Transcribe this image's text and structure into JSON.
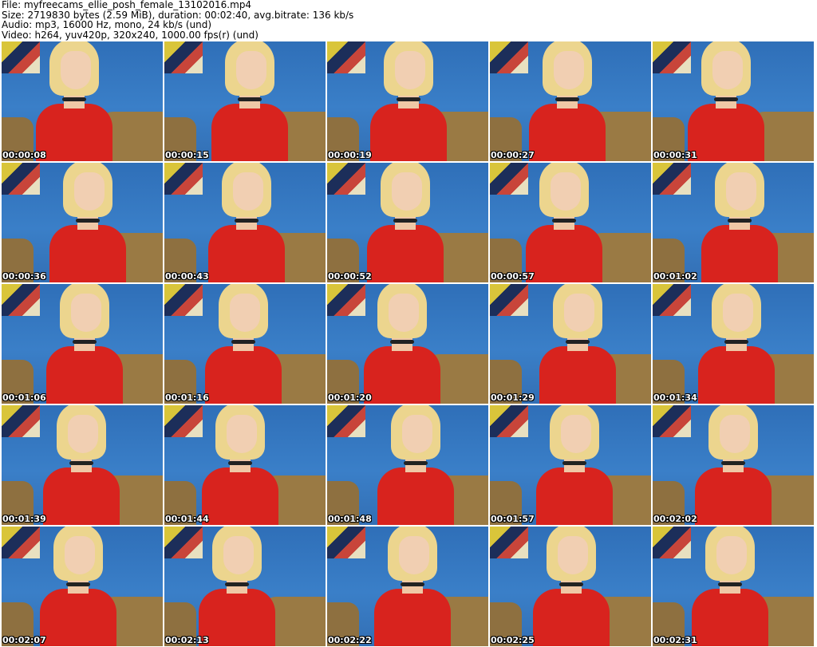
{
  "header": {
    "file": "File: myfreecams_ellie_posh_female_13102016.mp4",
    "size": "Size: 2719830 bytes (2.59 MiB), duration: 00:02:40, avg.bitrate: 136 kb/s",
    "audio": "Audio: mp3, 16000 Hz, mono, 24 kb/s (und)",
    "video": "Video: h264, yuv420p, 320x240, 1000.00 fps(r) (und)"
  },
  "thumbnails": [
    "00:00:08",
    "00:00:15",
    "00:00:19",
    "00:00:27",
    "00:00:31",
    "00:00:36",
    "00:00:43",
    "00:00:52",
    "00:00:57",
    "00:01:02",
    "00:01:06",
    "00:01:16",
    "00:01:20",
    "00:01:29",
    "00:01:34",
    "00:01:39",
    "00:01:44",
    "00:01:48",
    "00:01:57",
    "00:02:02",
    "00:02:07",
    "00:02:13",
    "00:02:22",
    "00:02:25",
    "00:02:31"
  ]
}
